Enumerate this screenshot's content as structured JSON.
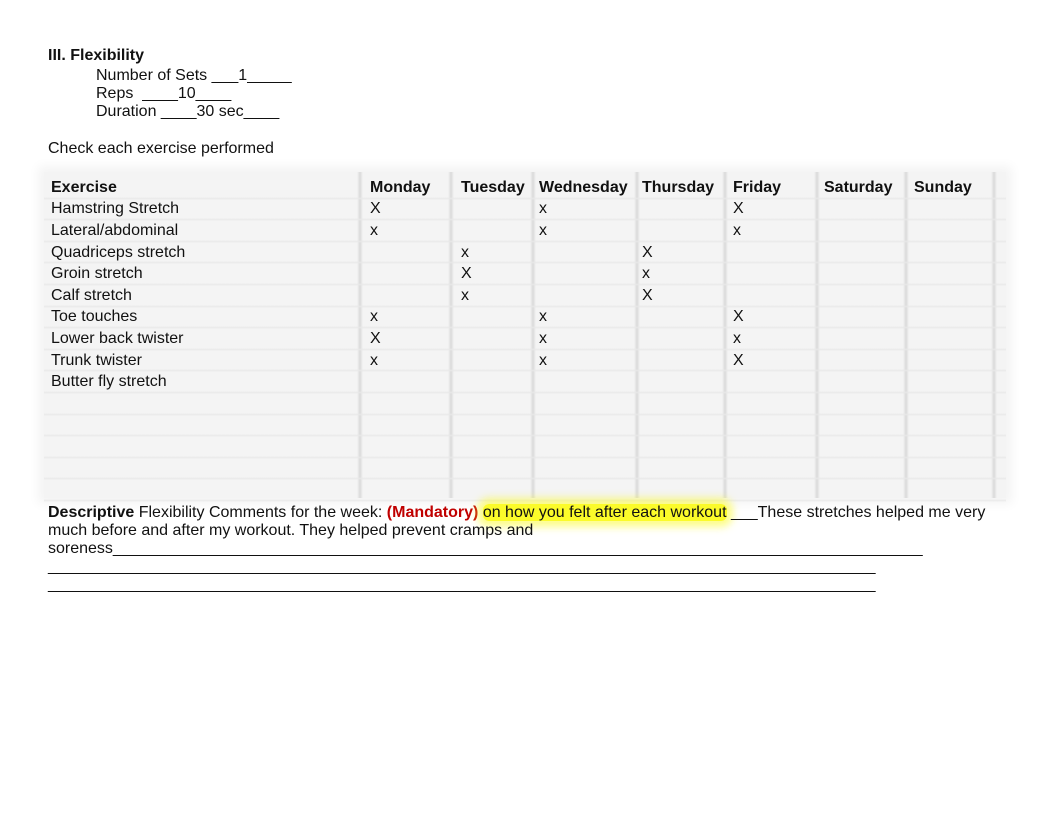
{
  "section": {
    "title": "III. Flexibility",
    "params": [
      {
        "label": "Number of Sets ___1_____"
      },
      {
        "label": "Reps  ____10____"
      },
      {
        "label": "Duration ____30 sec____"
      }
    ],
    "instruction": "Check each exercise performed"
  },
  "table": {
    "headers": [
      "Exercise",
      "Monday",
      "Tuesday",
      "Wednesday",
      "Thursday",
      "Friday",
      "Saturday",
      "Sunday"
    ],
    "rows": [
      [
        "Hamstring Stretch",
        "X",
        "",
        "x",
        "",
        "X",
        "",
        ""
      ],
      [
        "Lateral/abdominal",
        "x",
        "",
        "x",
        "",
        "x",
        "",
        ""
      ],
      [
        "Quadriceps stretch",
        "",
        "x",
        "",
        "X",
        "",
        "",
        ""
      ],
      [
        "Groin stretch",
        "",
        "X",
        "",
        "x",
        "",
        "",
        ""
      ],
      [
        "Calf stretch",
        "",
        "x",
        "",
        "X",
        "",
        "",
        ""
      ],
      [
        "Toe touches",
        "x",
        "",
        "x",
        "",
        "X",
        "",
        ""
      ],
      [
        "Lower back twister",
        "X",
        "",
        "x",
        "",
        "x",
        "",
        ""
      ],
      [
        "Trunk twister",
        "x",
        "",
        "x",
        "",
        "X",
        "",
        ""
      ],
      [
        "Butter fly stretch",
        "",
        "",
        "",
        "",
        "",
        "",
        ""
      ],
      [
        "",
        "",
        "",
        "",
        "",
        "",
        "",
        ""
      ],
      [
        "",
        "",
        "",
        "",
        "",
        "",
        "",
        ""
      ],
      [
        "",
        "",
        "",
        "",
        "",
        "",
        "",
        ""
      ],
      [
        "",
        "",
        "",
        "",
        "",
        "",
        "",
        ""
      ],
      [
        "",
        "",
        "",
        "",
        "",
        "",
        "",
        ""
      ]
    ]
  },
  "comments": {
    "label_bold": "Descriptive",
    "label_rest": " Flexibility Comments for the week: ",
    "mandatory": "(Mandatory)",
    "space": " ",
    "highlighted": "on how you felt after each workout",
    "response": " ___These stretches helped me very much before and after my workout. They helped prevent cramps and soreness___________________________________________________________________________________________",
    "blank_line_1": "_____________________________________________________________________________________________",
    "blank_line_2": "_____________________________________________________________________________________________"
  },
  "colors": {
    "mandatory": "#c00000",
    "highlight": "#fbfb2a",
    "table_bg": "#f4f4f4"
  }
}
